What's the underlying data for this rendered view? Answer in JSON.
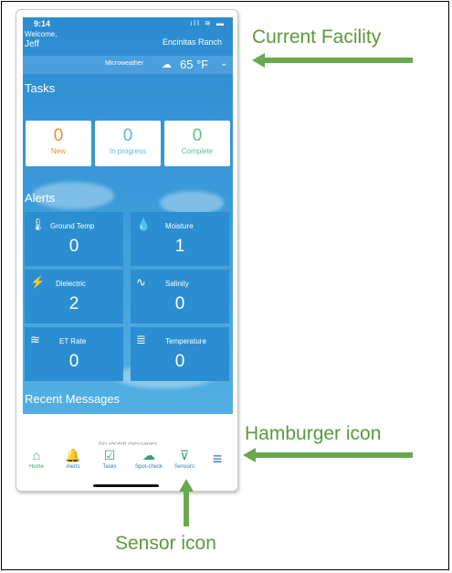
{
  "status": {
    "time": "9:14",
    "icons": "ıll ≋ ▬"
  },
  "header": {
    "welcome": "Welcome,",
    "user": "Jeff",
    "facility": "Encinitas Ranch"
  },
  "weather": {
    "label": "Microweather",
    "icon": "cloud-icon",
    "temp": "65 °F"
  },
  "tasks": {
    "title": "Tasks",
    "items": [
      {
        "value": "0",
        "label": "New",
        "color": "#f08a2c"
      },
      {
        "value": "0",
        "label": "In progress",
        "color": "#5fb3e6"
      },
      {
        "value": "0",
        "label": "Complete",
        "color": "#5cc28a"
      }
    ]
  },
  "alerts": {
    "title": "Alerts",
    "items": [
      {
        "label": "Ground Temp",
        "value": "0",
        "icon": "thermometer-icon"
      },
      {
        "label": "Moisture",
        "value": "1",
        "icon": "moisture-icon"
      },
      {
        "label": "Dielectric",
        "value": "2",
        "icon": "lightning-icon"
      },
      {
        "label": "Salinity",
        "value": "0",
        "icon": "salinity-icon"
      },
      {
        "label": "ET Rate",
        "value": "0",
        "icon": "heat-icon"
      },
      {
        "label": "Temperature",
        "value": "0",
        "icon": "temperature-icon"
      }
    ]
  },
  "messages": {
    "title": "Recent Messages",
    "empty": "No recent messages"
  },
  "nav": {
    "items": [
      {
        "label": "Home",
        "icon": "home-icon"
      },
      {
        "label": "Alerts",
        "icon": "bell-icon"
      },
      {
        "label": "Tasks",
        "icon": "tasks-icon"
      },
      {
        "label": "Spot-check",
        "icon": "spot-check-icon"
      },
      {
        "label": "Sensors",
        "icon": "sensor-icon"
      }
    ],
    "menu_icon": "hamburger-icon"
  },
  "annotations": {
    "current_facility": "Current Facility",
    "hamburger": "Hamburger icon",
    "sensor": "Sensor icon"
  },
  "colors": {
    "accent_green": "#6aa84f",
    "tile_blue": "#2a8ed0"
  }
}
